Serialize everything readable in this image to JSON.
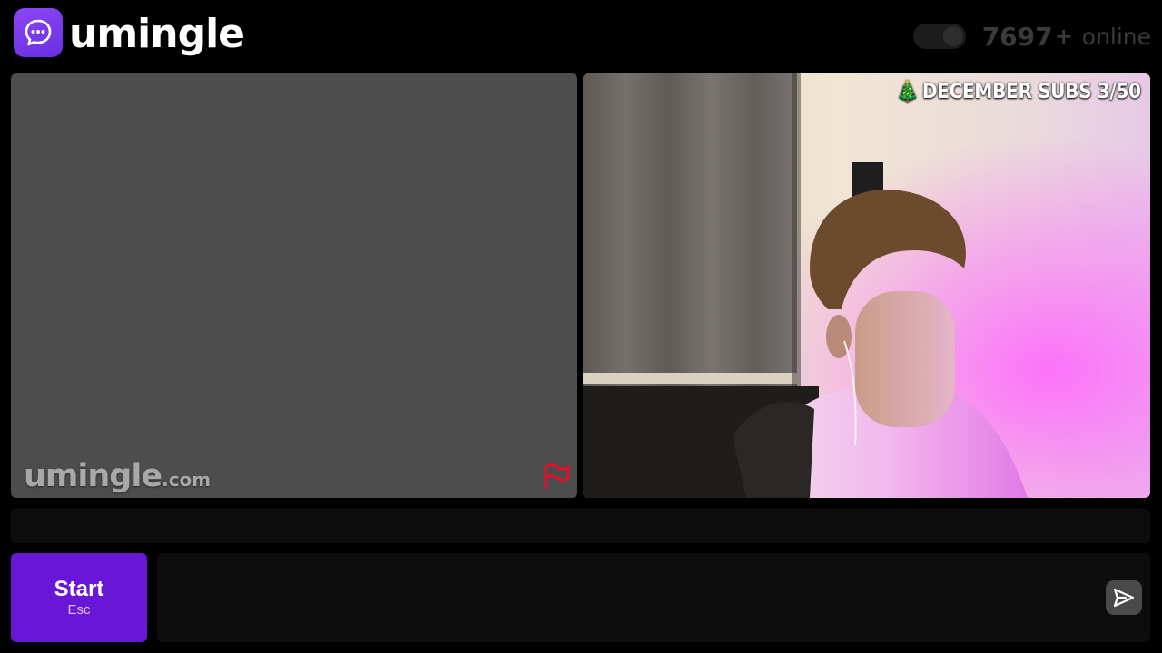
{
  "app": {
    "name": "umingle",
    "logo_icon": "chat-bubble-icon",
    "brand_color": "#7c3aed"
  },
  "header": {
    "online_toggle_icon": "toggle-switch",
    "online_count": "7697",
    "online_plus": "+",
    "online_label": "online"
  },
  "stranger_video": {
    "watermark_main": "umingle",
    "watermark_tld": ".com",
    "report_icon": "flag-icon",
    "report_color": "#e0112b"
  },
  "self_video": {
    "overlay_emoji": "🎄",
    "overlay_text": "DECEMBER SUBS 3/50"
  },
  "controls": {
    "start_label": "Start",
    "start_key": "Esc",
    "start_color": "#6a16d6",
    "message_value": "",
    "send_icon": "send-arrow-icon"
  }
}
